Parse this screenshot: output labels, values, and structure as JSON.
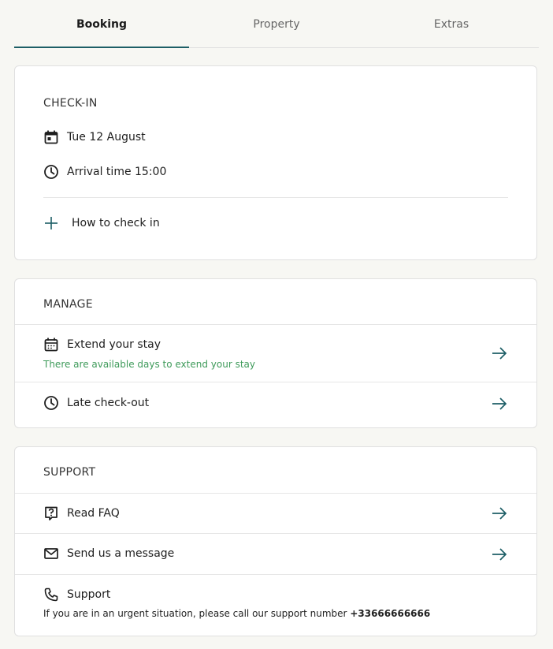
{
  "tabs": [
    {
      "label": "Booking",
      "active": true
    },
    {
      "label": "Property",
      "active": false
    },
    {
      "label": "Extras",
      "active": false
    }
  ],
  "checkin": {
    "title": "CHECK-IN",
    "date": "Tue 12 August",
    "arrival": "Arrival time 15:00",
    "how_to": "How to check in"
  },
  "manage": {
    "title": "MANAGE",
    "extend_label": "Extend your stay",
    "extend_note": "There are available days to extend your stay",
    "late_label": "Late check-out"
  },
  "support": {
    "title": "SUPPORT",
    "faq_label": "Read FAQ",
    "message_label": "Send us a message",
    "support_label": "Support",
    "urgent_text": "If you are in an urgent situation, please call our support number ",
    "phone": "+33666666666"
  },
  "colors": {
    "accent": "#1d5e66",
    "green": "#3f9b5b",
    "background": "#f7f7f3"
  },
  "icons": {
    "calendar": "calendar-icon",
    "clock": "clock-icon",
    "plus": "plus-icon",
    "arrow": "arrow-right-icon",
    "faq": "question-icon",
    "mail": "mail-icon",
    "phone": "phone-icon"
  }
}
